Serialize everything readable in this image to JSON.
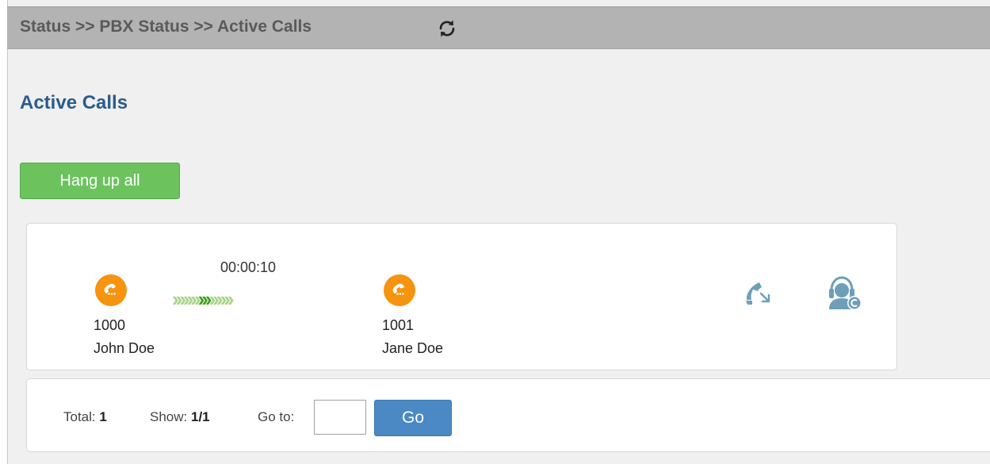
{
  "breadcrumb": {
    "text": "Status >> PBX Status >> Active Calls"
  },
  "page": {
    "title": "Active Calls"
  },
  "actions": {
    "hangup_all_label": "Hang up all"
  },
  "call": {
    "duration": "00:00:10",
    "caller": {
      "number": "1000",
      "name": "John Doe"
    },
    "callee": {
      "number": "1001",
      "name": "Jane Doe"
    },
    "transfer_icon": "call-transfer-icon",
    "monitor_icon": "call-monitor-icon"
  },
  "pager": {
    "total_label": "Total:",
    "total_value": "1",
    "show_label": "Show:",
    "show_value": "1/1",
    "goto_label": "Go to:",
    "goto_value": "",
    "go_label": "Go"
  },
  "colors": {
    "breadcrumb_bg": "#b3b3b3",
    "title": "#2b5c8a",
    "hangup_button": "#6cc35e",
    "party_icon": "#f6930f",
    "arrow_light": "#a8d48a",
    "arrow_dark": "#3f9e1e",
    "action_icon": "#6e9fb8",
    "go_button": "#4a89c4"
  }
}
